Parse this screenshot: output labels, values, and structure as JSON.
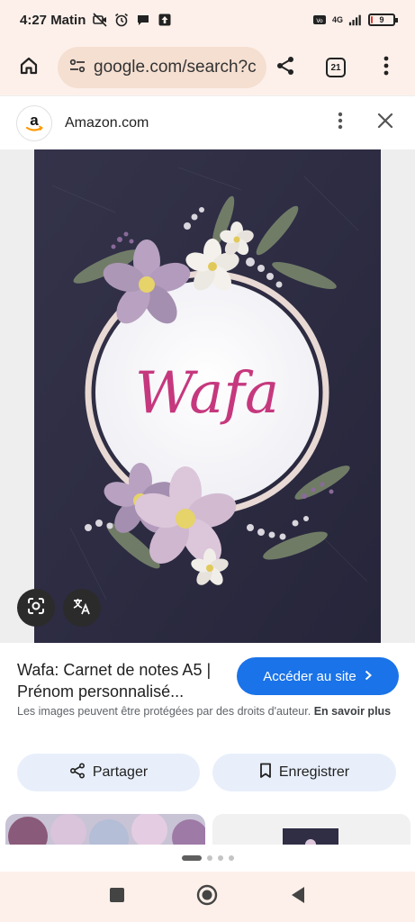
{
  "status_bar": {
    "time": "4:27 Matin",
    "network": "4G",
    "battery_level": "9",
    "battery_fraction": 0.09,
    "battery_color": "#e53935"
  },
  "toolbar": {
    "url": "google.com/search?c",
    "tab_count": "21",
    "icons": [
      "home-icon",
      "site-settings-icon",
      "share-icon",
      "tab-switcher-icon",
      "more-vert-icon"
    ]
  },
  "sheet": {
    "site_name": "Amazon.com",
    "logo_letter": "a"
  },
  "image": {
    "script_name": "Wafa",
    "background": "#2f2e45",
    "accent": "#c6387e"
  },
  "result": {
    "title": "Wafa: Carnet de notes A5 | Prénom personnalisé...",
    "visit_label": "Accéder au site",
    "copyright_text": "Les images peuvent être protégées par des droits d'auteur.",
    "learn_more": "En savoir plus",
    "share_label": "Partager",
    "save_label": "Enregistrer",
    "accent": "#1a73e8"
  },
  "pager": {
    "count": 4,
    "active_index": 0
  }
}
